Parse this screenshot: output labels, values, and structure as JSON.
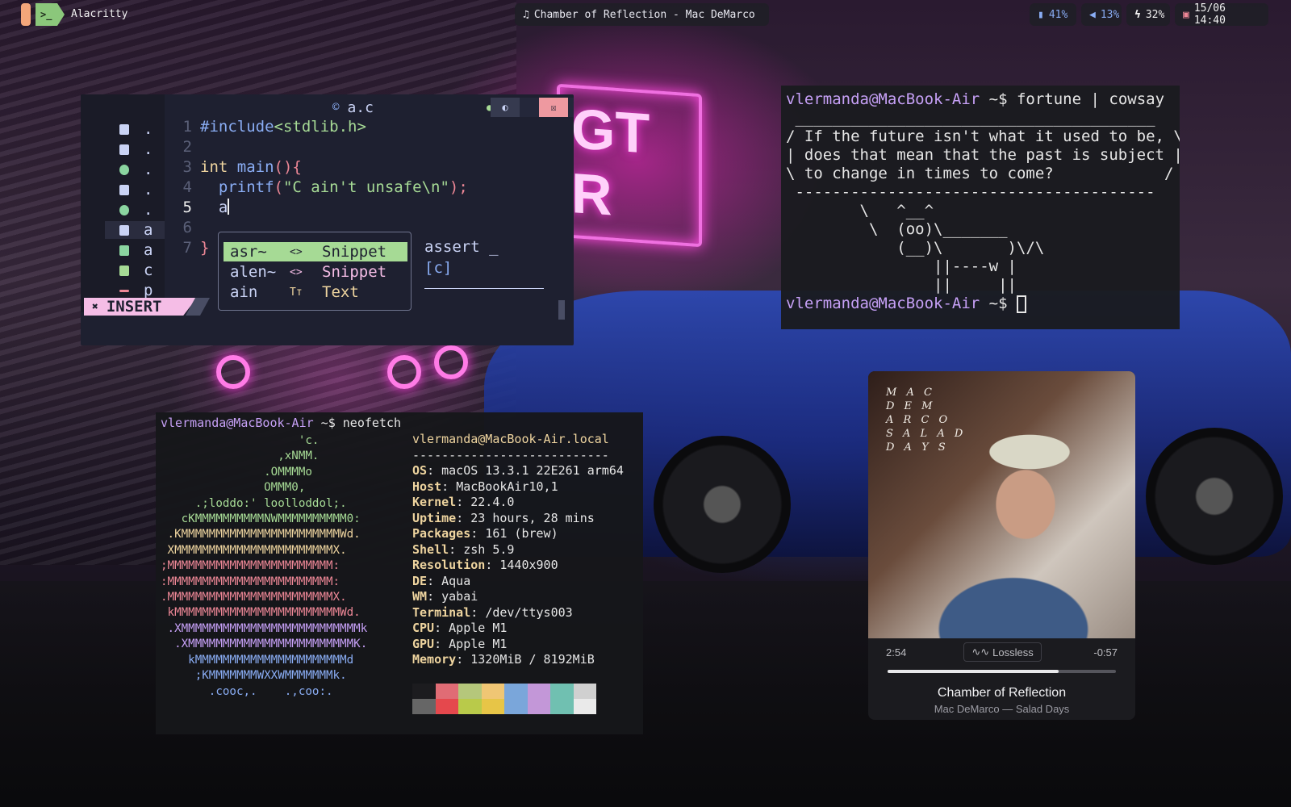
{
  "topbar": {
    "app_badge_icon": ">_",
    "app_name": "Alacritty",
    "now_playing": "Chamber of Reflection - Mac DeMarco",
    "cpu": "41%",
    "volume": "13%",
    "battery": "32%",
    "datetime": "15/06 14:40"
  },
  "editor": {
    "tab_title": "a.c",
    "tree": [
      ".",
      ".",
      ".",
      ".",
      ".",
      "a",
      "a",
      "c",
      "p"
    ],
    "lines": {
      "l1_num": "1",
      "l1_pp": "#include",
      "l1_hdr": "<stdlib.h>",
      "l2_num": "2",
      "l3_num": "3",
      "l3_kw": "int",
      "l3_fn": "main",
      "l3_rest": "(){",
      "l4_num": "4",
      "l4_fn": "printf",
      "l4_open": "(",
      "l4_str": "\"C ain't unsafe\\n\"",
      "l4_close": ");",
      "l5_num": "5",
      "l5_text": "a",
      "l6_num": "6",
      "l7_num": "7",
      "l7_text": "}"
    },
    "completion": [
      {
        "word": "asr~",
        "kind_icon": "<>",
        "kind": "Snippet"
      },
      {
        "word": "alen~",
        "kind_icon": "<>",
        "kind": "Snippet"
      },
      {
        "word": "ain",
        "kind_icon": "Tт",
        "kind": "Text"
      }
    ],
    "doc_line1": "assert _",
    "doc_line2": "[c]",
    "mode": "INSERT"
  },
  "cowsay": {
    "prompt_user": "vlermanda@MacBook-Air",
    "prompt_suffix": " ~$ ",
    "command": "fortune | cowsay",
    "output": " _______________________________________\n/ If the future isn't what it used to be, \\\n| does that mean that the past is subject |\n\\ to change in times to come?            /\n ---------------------------------------\n        \\   ^__^\n         \\  (oo)\\_______\n            (__)\\       )\\/\\\n                ||----w |\n                ||     ||"
  },
  "neofetch": {
    "prompt_user": "vlermanda@MacBook-Air",
    "prompt_suffix": " ~$ ",
    "command": "neofetch",
    "ascii": [
      {
        "text": "                    'c.",
        "color": "#a6da95"
      },
      {
        "text": "                 ,xNMM.",
        "color": "#a6da95"
      },
      {
        "text": "               .OMMMMo",
        "color": "#a6da95"
      },
      {
        "text": "               OMMM0,",
        "color": "#a6da95"
      },
      {
        "text": "     .;loddo:' loolloddol;.",
        "color": "#a6da95"
      },
      {
        "text": "   cKMMMMMMMMMMNWMMMMMMMMMM0:",
        "color": "#a6da95"
      },
      {
        "text": " .KMMMMMMMMMMMMMMMMMMMMMMMWd.",
        "color": "#eed49f"
      },
      {
        "text": " XMMMMMMMMMMMMMMMMMMMMMMMX.",
        "color": "#eed49f"
      },
      {
        "text": ";MMMMMMMMMMMMMMMMMMMMMMMM:",
        "color": "#ed8796"
      },
      {
        "text": ":MMMMMMMMMMMMMMMMMMMMMMMM:",
        "color": "#ed8796"
      },
      {
        "text": ".MMMMMMMMMMMMMMMMMMMMMMMMX.",
        "color": "#ed8796"
      },
      {
        "text": " kMMMMMMMMMMMMMMMMMMMMMMMMWd.",
        "color": "#ed8796"
      },
      {
        "text": " .XMMMMMMMMMMMMMMMMMMMMMMMMMMk",
        "color": "#c6a0f6"
      },
      {
        "text": "  .XMMMMMMMMMMMMMMMMMMMMMMMMK.",
        "color": "#c6a0f6"
      },
      {
        "text": "    kMMMMMMMMMMMMMMMMMMMMMMd",
        "color": "#8aadf4"
      },
      {
        "text": "     ;KMMMMMMMWXXWMMMMMMMk.",
        "color": "#8aadf4"
      },
      {
        "text": "       .cooc,.    .,coo:.",
        "color": "#8aadf4"
      }
    ],
    "header": "vlermanda@MacBook-Air.local",
    "divider": "---------------------------",
    "info": [
      {
        "key": "OS",
        "value": "macOS 13.3.1 22E261 arm64"
      },
      {
        "key": "Host",
        "value": "MacBookAir10,1"
      },
      {
        "key": "Kernel",
        "value": "22.4.0"
      },
      {
        "key": "Uptime",
        "value": "23 hours, 28 mins"
      },
      {
        "key": "Packages",
        "value": "161 (brew)"
      },
      {
        "key": "Shell",
        "value": "zsh 5.9"
      },
      {
        "key": "Resolution",
        "value": "1440x900"
      },
      {
        "key": "DE",
        "value": "Aqua"
      },
      {
        "key": "WM",
        "value": "yabai"
      },
      {
        "key": "Terminal",
        "value": "/dev/ttys003"
      },
      {
        "key": "CPU",
        "value": "Apple M1"
      },
      {
        "key": "GPU",
        "value": "Apple M1"
      },
      {
        "key": "Memory",
        "value": "1320MiB / 8192MiB"
      }
    ],
    "palette_top": [
      "#1c1c1f",
      "#e06c75",
      "#b5c77b",
      "#f0c674",
      "#7aa6da",
      "#c397d8",
      "#70c0b1",
      "#d0d0d0"
    ],
    "palette_bottom": [
      "#666666",
      "#e5484d",
      "#b9ca4a",
      "#e7c547",
      "#7aa6da",
      "#c397d8",
      "#70c0b1",
      "#eaeaea"
    ]
  },
  "player": {
    "art_text": "M A C\nD E M\nA R C O\nS A L A D\nD A Y S",
    "elapsed": "2:54",
    "remaining": "-0:57",
    "quality": "Lossless",
    "progress": 0.75,
    "title": "Chamber of Reflection",
    "subtitle": "Mac DeMarco — Salad Days"
  }
}
